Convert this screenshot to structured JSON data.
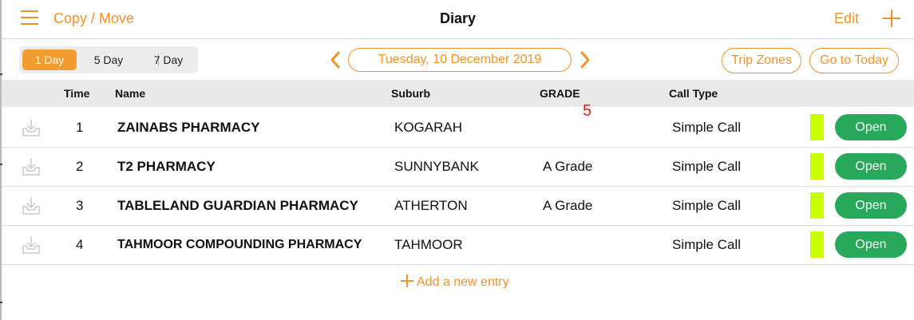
{
  "nav": {
    "copy_move": "Copy / Move",
    "title": "Diary",
    "edit": "Edit"
  },
  "toolbar": {
    "segments": [
      "1 Day",
      "5 Day",
      "7 Day"
    ],
    "active_segment": "1 Day",
    "date": "Tuesday, 10 December 2019",
    "trip_zones": "Trip Zones",
    "go_to_today": "Go to Today"
  },
  "table": {
    "headers": {
      "time": "Time",
      "name": "Name",
      "suburb": "Suburb",
      "grade": "GRADE",
      "call_type": "Call Type"
    },
    "rows": [
      {
        "time": "1",
        "name": "ZAINABS PHARMACY",
        "suburb": "KOGARAH",
        "grade": "",
        "call_type": "Simple Call",
        "action": "Open"
      },
      {
        "time": "2",
        "name": "T2 PHARMACY",
        "suburb": "SUNNYBANK",
        "grade": "A Grade",
        "call_type": "Simple Call",
        "action": "Open"
      },
      {
        "time": "3",
        "name": "TABLELAND GUARDIAN PHARMACY",
        "suburb": "ATHERTON",
        "grade": "A Grade",
        "call_type": "Simple Call",
        "action": "Open"
      },
      {
        "time": "4",
        "name": "TAHMOOR COMPOUNDING PHARMACY",
        "suburb": "TAHMOOR",
        "grade": "",
        "call_type": "Simple Call",
        "action": "Open"
      }
    ]
  },
  "annotation": "5",
  "add_entry": "Add a new entry",
  "colors": {
    "accent": "#f0932b",
    "open_button": "#27a85a",
    "status_bar": "#c8ff00",
    "annotation": "#e02020"
  },
  "icons": [
    "menu-icon",
    "plus-icon",
    "chevron-left-icon",
    "chevron-right-icon",
    "download-tray-icon"
  ]
}
